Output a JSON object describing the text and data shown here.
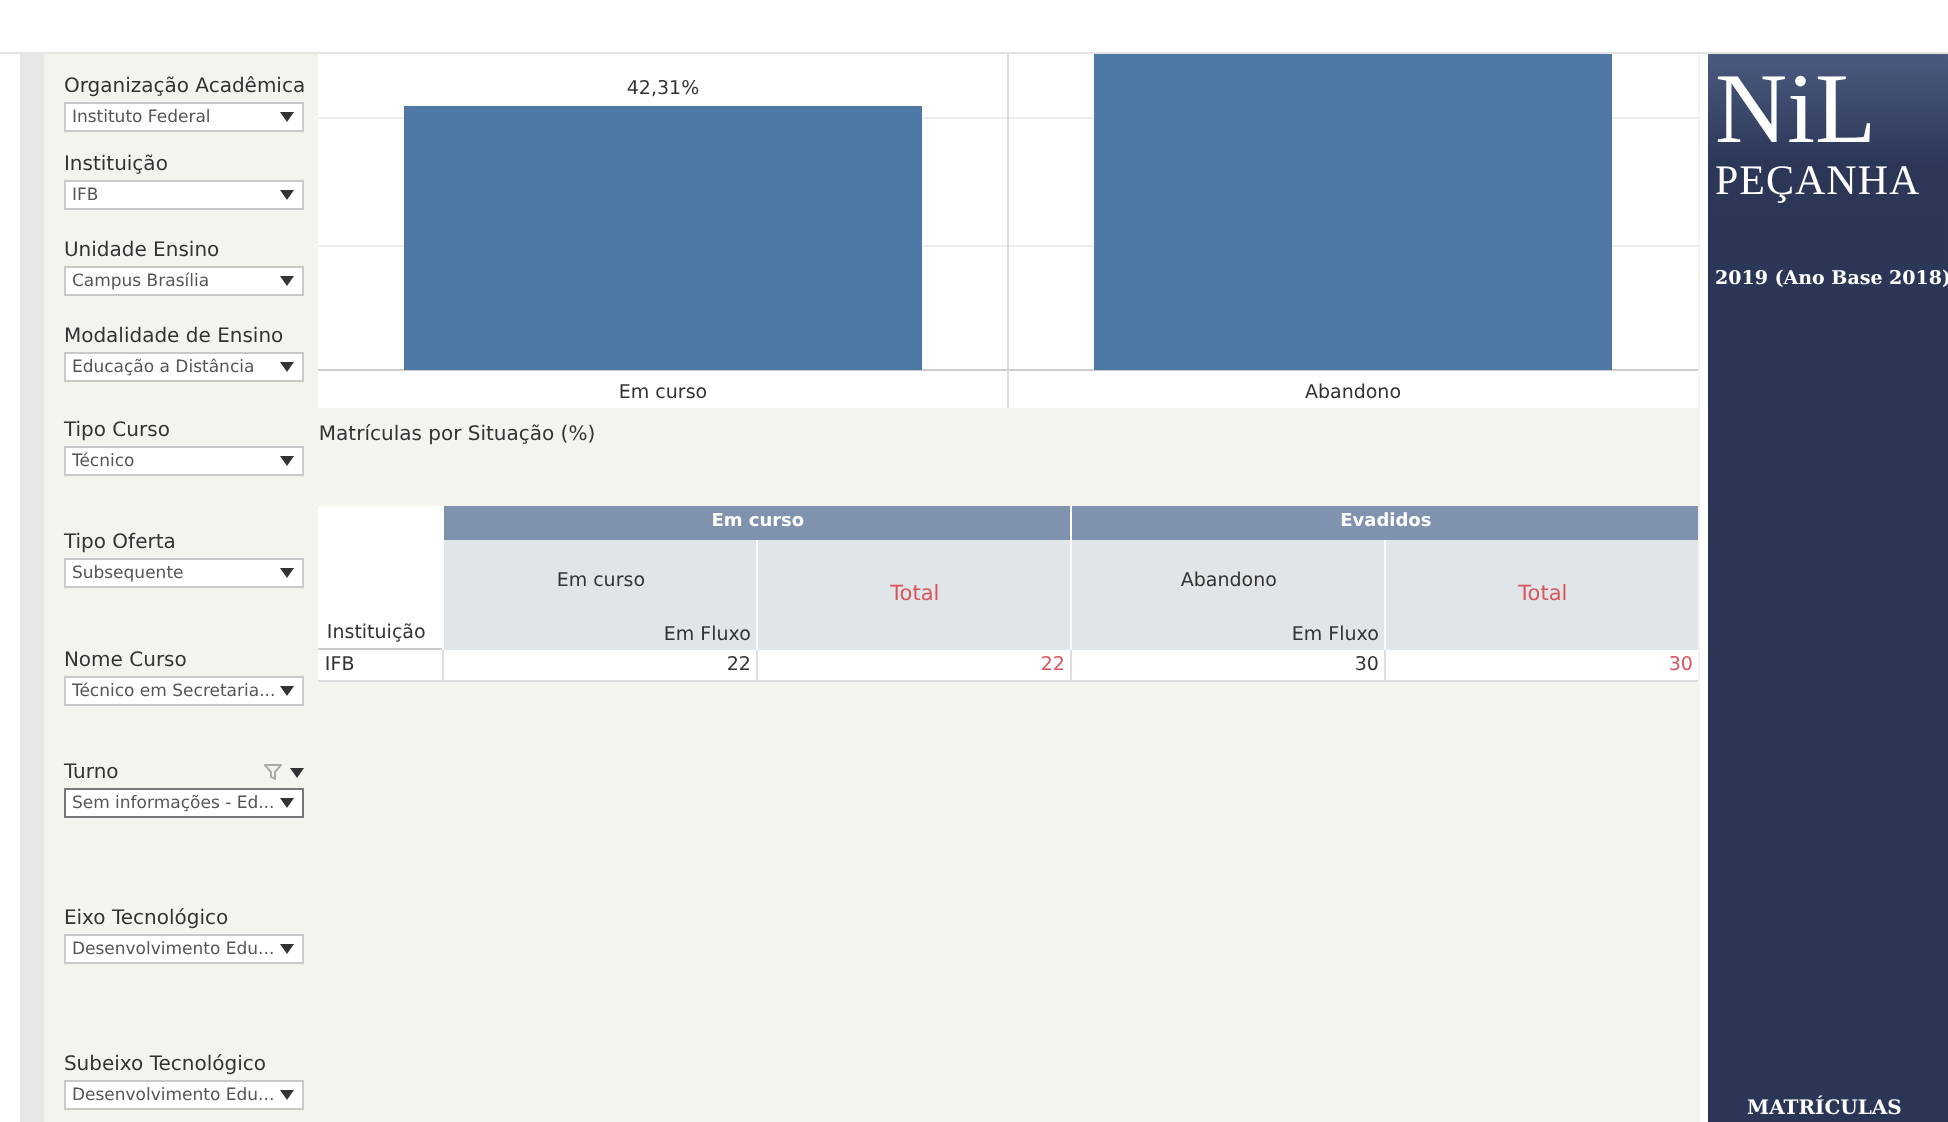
{
  "filters": [
    {
      "label": "Organização Acadêmica",
      "value": "Instituto Federal",
      "filter_applied": false
    },
    {
      "label": "Instituição",
      "value": "IFB",
      "filter_applied": false
    },
    {
      "label": "Unidade Ensino",
      "value": "Campus Brasília",
      "filter_applied": false
    },
    {
      "label": "Modalidade de Ensino",
      "value": "Educação a Distância",
      "filter_applied": false
    },
    {
      "label": "Tipo Curso",
      "value": "Técnico",
      "filter_applied": false
    },
    {
      "label": "Tipo Oferta",
      "value": "Subsequente",
      "filter_applied": false
    },
    {
      "label": "Nome Curso",
      "value": "Técnico em Secretaria...",
      "filter_applied": false
    },
    {
      "label": "Turno",
      "value": "Sem informações - Ed...",
      "filter_applied": true
    },
    {
      "label": "Eixo Tecnológico",
      "value": "Desenvolvimento Edu...",
      "filter_applied": false
    },
    {
      "label": "Subeixo Tecnológico",
      "value": "Desenvolvimento Edu...",
      "filter_applied": false
    }
  ],
  "chart": {
    "categories": [
      "Em curso",
      "Abandono"
    ],
    "bar_labels": [
      "42,31%"
    ]
  },
  "table": {
    "title": "Matrículas por Situação (%)",
    "row_header": "Instituição",
    "groups": [
      {
        "label": "Em curso",
        "columns": [
          {
            "label": "Em curso",
            "sublabel": "Em Fluxo",
            "kind": "value"
          },
          {
            "label": "Total",
            "kind": "total"
          }
        ]
      },
      {
        "label": "Evadidos",
        "columns": [
          {
            "label": "Abandono",
            "sublabel": "Em Fluxo",
            "kind": "value"
          },
          {
            "label": "Total",
            "kind": "total"
          }
        ]
      }
    ],
    "rows": [
      {
        "cells": [
          "IFB",
          "22",
          "22",
          "30",
          "30"
        ]
      }
    ]
  },
  "brand": {
    "logo_top": "NiL",
    "logo_bottom": "PEÇANHA",
    "subtitle": "2019 (Ano Base 2018)",
    "section": "MATRÍCULAS"
  }
}
